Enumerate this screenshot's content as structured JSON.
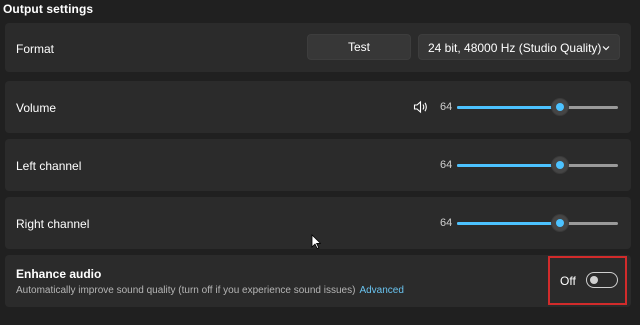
{
  "section_title": "Output settings",
  "format": {
    "label": "Format",
    "test_button": "Test",
    "dropdown_value": "24 bit, 48000 Hz (Studio Quality)",
    "dropdown_icon": "chevron-down-icon"
  },
  "volume": {
    "label": "Volume",
    "value": "64",
    "level": 0.64,
    "icon": "speaker-icon"
  },
  "left_channel": {
    "label": "Left channel",
    "value": "64",
    "level": 0.64
  },
  "right_channel": {
    "label": "Right channel",
    "value": "64",
    "level": 0.64
  },
  "enhance": {
    "title": "Enhance audio",
    "description": "Automatically improve sound quality (turn off if you experience sound issues)",
    "advanced_link": "Advanced",
    "toggle_label": "Off",
    "toggle_on": false
  },
  "colors": {
    "background": "#202020",
    "card": "#2b2b2b",
    "accent": "#4cc2ff",
    "link": "#69c3ef",
    "highlight": "#d12b2b"
  }
}
